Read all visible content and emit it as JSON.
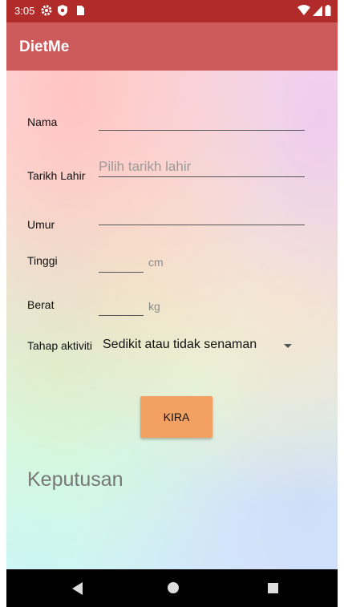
{
  "status_bar": {
    "time": "3:05",
    "icons": [
      "settings-icon",
      "shield-icon",
      "sd-card-icon",
      "wifi-icon",
      "signal-icon",
      "battery-icon"
    ]
  },
  "app_bar": {
    "title": "DietMe"
  },
  "form": {
    "nama_label": "Nama",
    "tarikh_label": "Tarikh Lahir",
    "tarikh_placeholder": "Pilih tarikh lahir",
    "umur_label": "Umur",
    "tinggi_label": "Tinggi",
    "tinggi_unit": "cm",
    "berat_label": "Berat",
    "berat_unit": "kg",
    "aktiviti_label": "Tahap aktiviti",
    "aktiviti_value": "Sedikit atau tidak senaman"
  },
  "button": {
    "kira_label": "KIRA"
  },
  "result": {
    "text": "Keputusan"
  },
  "colors": {
    "status_bar": "#b12b2b",
    "app_bar": "#cd5b5b",
    "button": "#f3a063"
  }
}
